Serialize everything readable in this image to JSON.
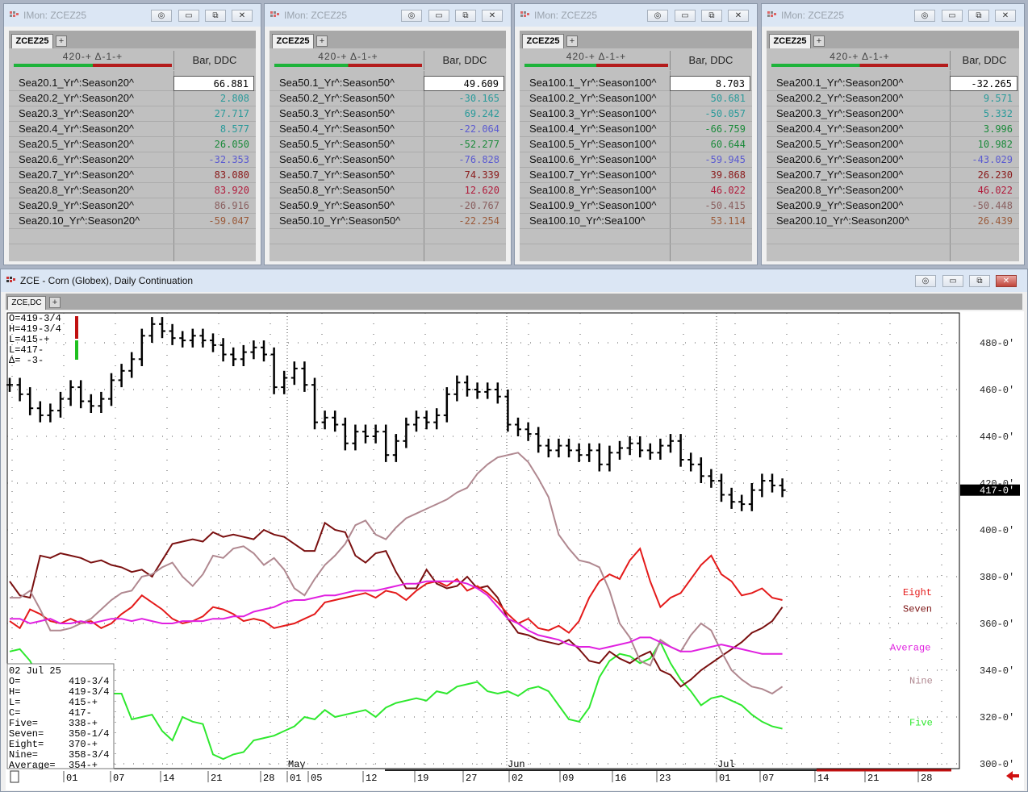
{
  "monitors": [
    {
      "title": "IMon: ZCEZ25",
      "tab": "ZCEZ25",
      "hdr_nums": "420-+    Δ-1-+",
      "hdr_col": "Bar, DDC",
      "rows": [
        {
          "name": "Sea20.1_Yr^:Season20^",
          "value": "66.881",
          "color": "#000000"
        },
        {
          "name": "Sea20.2_Yr^:Season20^",
          "value": "2.808",
          "color": "#2a9a9a"
        },
        {
          "name": "Sea20.3_Yr^:Season20^",
          "value": "27.717",
          "color": "#2a9a9a"
        },
        {
          "name": "Sea20.4_Yr^:Season20^",
          "value": "8.577",
          "color": "#2a9a9a"
        },
        {
          "name": "Sea20.5_Yr^:Season20^",
          "value": "26.050",
          "color": "#1a8a3a"
        },
        {
          "name": "Sea20.6_Yr^:Season20^",
          "value": "-32.353",
          "color": "#5b5bd0"
        },
        {
          "name": "Sea20.7_Yr^:Season20^",
          "value": "83.080",
          "color": "#8a1a1a"
        },
        {
          "name": "Sea20.8_Yr^:Season20^",
          "value": "83.920",
          "color": "#b01a3a"
        },
        {
          "name": "Sea20.9_Yr^:Season20^",
          "value": "86.916",
          "color": "#8a6060"
        },
        {
          "name": "Sea20.10_Yr^:Season20^",
          "value": "-59.047",
          "color": "#9a5a3a"
        }
      ]
    },
    {
      "title": "IMon: ZCEZ25",
      "tab": "ZCEZ25",
      "hdr_nums": "420-+    Δ-1-+",
      "hdr_col": "Bar, DDC",
      "rows": [
        {
          "name": "Sea50.1_Yr^:Season50^",
          "value": "49.609",
          "color": "#000000"
        },
        {
          "name": "Sea50.2_Yr^:Season50^",
          "value": "-30.165",
          "color": "#2a9a9a"
        },
        {
          "name": "Sea50.3_Yr^:Season50^",
          "value": "69.242",
          "color": "#2a9a9a"
        },
        {
          "name": "Sea50.4_Yr^:Season50^",
          "value": "-22.064",
          "color": "#5b5bd0"
        },
        {
          "name": "Sea50.5_Yr^:Season50^",
          "value": "-52.277",
          "color": "#1a8a3a"
        },
        {
          "name": "Sea50.6_Yr^:Season50^",
          "value": "-76.828",
          "color": "#5b5bd0"
        },
        {
          "name": "Sea50.7_Yr^:Season50^",
          "value": "74.339",
          "color": "#8a1a1a"
        },
        {
          "name": "Sea50.8_Yr^:Season50^",
          "value": "12.620",
          "color": "#b01a3a"
        },
        {
          "name": "Sea50.9_Yr^:Season50^",
          "value": "-20.767",
          "color": "#8a6060"
        },
        {
          "name": "Sea50.10_Yr^:Season50^",
          "value": "-22.254",
          "color": "#9a5a3a"
        }
      ]
    },
    {
      "title": "IMon: ZCEZ25",
      "tab": "ZCEZ25",
      "hdr_nums": "420-+    Δ-1-+",
      "hdr_col": "Bar, DDC",
      "rows": [
        {
          "name": "Sea100.1_Yr^:Season100^",
          "value": "8.703",
          "color": "#000000"
        },
        {
          "name": "Sea100.2_Yr^:Season100^",
          "value": "50.681",
          "color": "#2a9a9a"
        },
        {
          "name": "Sea100.3_Yr^:Season100^",
          "value": "-50.057",
          "color": "#2a9a9a"
        },
        {
          "name": "Sea100.4_Yr^:Season100^",
          "value": "-66.759",
          "color": "#1a8a3a"
        },
        {
          "name": "Sea100.5_Yr^:Season100^",
          "value": "60.644",
          "color": "#1a8a3a"
        },
        {
          "name": "Sea100.6_Yr^:Season100^",
          "value": "-59.945",
          "color": "#5b5bd0"
        },
        {
          "name": "Sea100.7_Yr^:Season100^",
          "value": "39.868",
          "color": "#8a1a1a"
        },
        {
          "name": "Sea100.8_Yr^:Season100^",
          "value": "46.022",
          "color": "#b01a3a"
        },
        {
          "name": "Sea100.9_Yr^:Season100^",
          "value": "-50.415",
          "color": "#8a6060"
        },
        {
          "name": "Sea100.10_Yr^:Sea100^",
          "value": "53.114",
          "color": "#9a5a3a"
        }
      ]
    },
    {
      "title": "IMon: ZCEZ25",
      "tab": "ZCEZ25",
      "hdr_nums": "420-+    Δ-1-+",
      "hdr_col": "Bar, DDC",
      "rows": [
        {
          "name": "Sea200.1_Yr^:Season200^",
          "value": "-32.265",
          "color": "#000000"
        },
        {
          "name": "Sea200.2_Yr^:Season200^",
          "value": "9.571",
          "color": "#2a9a9a"
        },
        {
          "name": "Sea200.3_Yr^:Season200^",
          "value": "5.332",
          "color": "#2a9a9a"
        },
        {
          "name": "Sea200.4_Yr^:Season200^",
          "value": "3.996",
          "color": "#1a8a3a"
        },
        {
          "name": "Sea200.5_Yr^:Season200^",
          "value": "10.982",
          "color": "#1a8a3a"
        },
        {
          "name": "Sea200.6_Yr^:Season200^",
          "value": "-43.029",
          "color": "#5b5bd0"
        },
        {
          "name": "Sea200.7_Yr^:Season200^",
          "value": "26.230",
          "color": "#8a1a1a"
        },
        {
          "name": "Sea200.8_Yr^:Season200^",
          "value": "46.022",
          "color": "#b01a3a"
        },
        {
          "name": "Sea200.9_Yr^:Season200^",
          "value": "-50.448",
          "color": "#8a6060"
        },
        {
          "name": "Sea200.10_Yr^:Season200^",
          "value": "26.439",
          "color": "#9a5a3a"
        }
      ]
    }
  ],
  "chart_window": {
    "title": "ZCE - Corn (Globex), Daily Continuation",
    "tab": "ZCE,DC"
  },
  "chart_data": {
    "type": "line",
    "price_bars": {
      "name": "ZCE",
      "ohlc_summary": {
        "open": "419-3/4",
        "high": "419-3/4",
        "low": "415-+",
        "last": "417-",
        "change": "-3-"
      },
      "close_values": [
        462,
        458,
        452,
        449,
        451,
        456,
        461,
        455,
        453,
        456,
        464,
        468,
        473,
        483,
        488,
        485,
        482,
        481,
        483,
        481,
        479,
        475,
        473,
        476,
        478,
        475,
        461,
        465,
        469,
        462,
        446,
        448,
        445,
        437,
        442,
        440,
        442,
        432,
        438,
        445,
        448,
        446,
        449,
        458,
        463,
        460,
        459,
        460,
        457,
        445,
        443,
        441,
        436,
        434,
        436,
        434,
        432,
        434,
        428,
        433,
        435,
        437,
        434,
        433,
        436,
        438,
        430,
        428,
        423,
        421,
        415,
        412,
        411,
        417,
        421,
        419,
        417
      ]
    },
    "overlay_axis_range": [
      300,
      490
    ],
    "series": [
      {
        "name": "Five",
        "color": "#2ee82e",
        "values": [
          348,
          349,
          344,
          336,
          332,
          330,
          332,
          329,
          329,
          331,
          330,
          330,
          319,
          320,
          321,
          314,
          310,
          320,
          318,
          317,
          304,
          302,
          304,
          305,
          310,
          311,
          312,
          314,
          316,
          320,
          319,
          323,
          320,
          321,
          322,
          323,
          320,
          324,
          326,
          327,
          328,
          327,
          331,
          330,
          333,
          334,
          335,
          331,
          330,
          331,
          329,
          332,
          333,
          331,
          325,
          319,
          318,
          324,
          337,
          344,
          347,
          346,
          343,
          345,
          352,
          343,
          336,
          331,
          325,
          328,
          329,
          327,
          325,
          321,
          318,
          316,
          315
        ]
      },
      {
        "name": "Seven",
        "color": "#7a1010",
        "values": [
          378,
          372,
          371,
          389,
          388,
          390,
          389,
          388,
          386,
          387,
          385,
          384,
          382,
          383,
          380,
          387,
          394,
          395,
          396,
          395,
          399,
          397,
          398,
          397,
          396,
          400,
          398,
          397,
          394,
          391,
          391,
          403,
          400,
          399,
          389,
          386,
          390,
          391,
          382,
          375,
          375,
          383,
          377,
          375,
          376,
          380,
          375,
          376,
          371,
          362,
          356,
          355,
          353,
          352,
          351,
          353,
          349,
          344,
          343,
          348,
          345,
          343,
          346,
          348,
          340,
          338,
          333,
          336,
          340,
          343,
          346,
          349,
          352,
          356,
          358,
          361,
          367
        ]
      },
      {
        "name": "Eight",
        "color": "#e41a1a",
        "values": [
          361,
          358,
          366,
          364,
          361,
          360,
          362,
          360,
          361,
          358,
          360,
          364,
          367,
          372,
          369,
          366,
          362,
          360,
          361,
          363,
          367,
          366,
          364,
          361,
          362,
          361,
          358,
          359,
          360,
          362,
          364,
          369,
          370,
          371,
          372,
          373,
          371,
          374,
          373,
          370,
          374,
          377,
          378,
          376,
          379,
          374,
          376,
          373,
          369,
          364,
          360,
          362,
          358,
          357,
          359,
          356,
          361,
          371,
          378,
          381,
          379,
          387,
          392,
          378,
          367,
          371,
          373,
          379,
          385,
          389,
          381,
          378,
          372,
          373,
          375,
          371,
          370
        ]
      },
      {
        "name": "Nine",
        "color": "#b08890",
        "values": [
          371,
          371,
          374,
          366,
          357,
          357,
          358,
          360,
          362,
          366,
          370,
          373,
          374,
          380,
          381,
          384,
          386,
          380,
          376,
          381,
          389,
          388,
          392,
          393,
          390,
          385,
          388,
          383,
          375,
          372,
          379,
          385,
          389,
          394,
          402,
          404,
          398,
          396,
          401,
          405,
          407,
          409,
          411,
          413,
          416,
          418,
          424,
          428,
          431,
          432,
          433,
          429,
          422,
          414,
          398,
          392,
          387,
          386,
          384,
          374,
          360,
          354,
          344,
          342,
          353,
          350,
          348,
          355,
          360,
          357,
          348,
          340,
          336,
          333,
          332,
          330,
          333
        ]
      },
      {
        "name": "Average",
        "color": "#e020e0",
        "values": [
          362,
          362,
          360,
          361,
          362,
          360,
          360,
          361,
          360,
          361,
          362,
          362,
          361,
          362,
          361,
          360,
          360,
          361,
          361,
          361,
          362,
          362,
          363,
          363,
          365,
          366,
          367,
          369,
          370,
          370,
          371,
          372,
          372,
          373,
          374,
          374,
          374,
          375,
          376,
          377,
          377,
          378,
          378,
          378,
          378,
          377,
          375,
          372,
          367,
          362,
          360,
          357,
          355,
          354,
          353,
          351,
          350,
          350,
          349,
          350,
          351,
          352,
          354,
          354,
          352,
          350,
          348,
          348,
          349,
          350,
          351,
          350,
          349,
          348,
          347,
          347,
          347
        ]
      }
    ],
    "y_ticks": [
      "480-0'",
      "460-0'",
      "440-0'",
      "420-0'",
      "400-0'",
      "380-0'",
      "360-0'",
      "340-0'",
      "320-0'",
      "300-0'"
    ],
    "last_price_tag": "417-0'",
    "month_labels": [
      "May",
      "Jun",
      "Jul"
    ],
    "x_ticks": [
      "01",
      "07",
      "14",
      "21",
      "28",
      "01",
      "05",
      "12",
      "19",
      "27",
      "02",
      "09",
      "16",
      "23",
      "01",
      "07",
      "14",
      "21",
      "28"
    ],
    "readout": {
      "date": "02 Jul 25",
      "lines": [
        [
          "O=",
          "419-3/4"
        ],
        [
          "H=",
          "419-3/4"
        ],
        [
          "L=",
          "415-+"
        ],
        [
          "C=",
          "417-"
        ],
        [
          "Five=",
          "338-+"
        ],
        [
          "Seven=",
          "350-1/4"
        ],
        [
          "Eight=",
          "370-+"
        ],
        [
          "Nine=",
          "358-3/4"
        ],
        [
          "Average=",
          "354-+"
        ]
      ]
    },
    "top_readout": [
      "O=419-3/4",
      "H=419-3/4",
      "L=415-+",
      "L=417-",
      "Δ= -3-"
    ]
  }
}
